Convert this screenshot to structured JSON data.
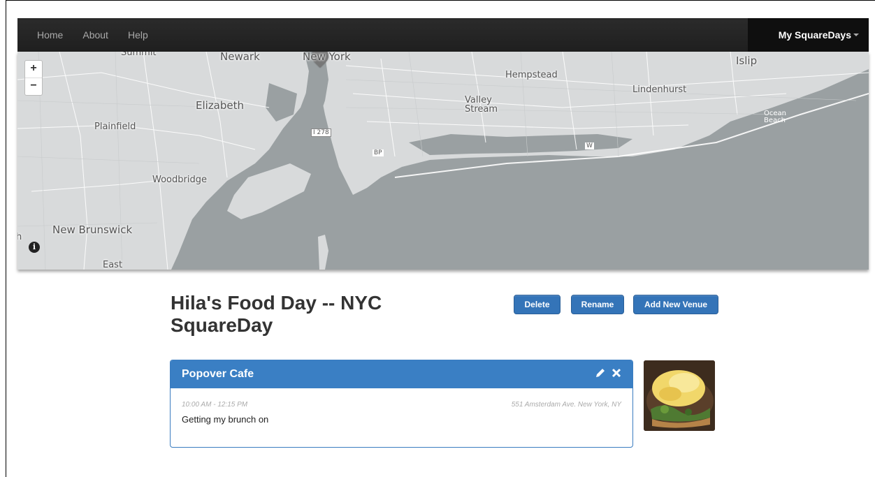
{
  "navbar": {
    "links": [
      "Home",
      "About",
      "Help"
    ],
    "account_menu": "My SquareDays"
  },
  "map": {
    "zoom_in": "+",
    "zoom_out": "−",
    "info": "i",
    "labels": [
      "Summit",
      "Newark",
      "New York",
      "Hempstead",
      "Islip",
      "Lindenhurst",
      "Elizabeth",
      "Valley Stream",
      "Plainfield",
      "Ocean Beach",
      "Woodbridge",
      "New Brunswick",
      "East",
      "I 278",
      "BP",
      "W",
      "h"
    ]
  },
  "day": {
    "title": "Hila's Food Day -- NYC SquareDay",
    "buttons": {
      "delete": "Delete",
      "rename": "Rename",
      "add_venue": "Add New Venue"
    }
  },
  "venue": {
    "name": "Popover Cafe",
    "time": "10:00 AM - 12:15 PM",
    "address": "551 Amsterdam Ave. New York, NY",
    "description": "Getting my brunch on",
    "icons": [
      "pencil-icon",
      "close-icon"
    ]
  },
  "colors": {
    "navbar": "#222222",
    "primary_button": "#3474b8",
    "panel_header": "#3a7fc4",
    "map_water": "#9aa0a2",
    "map_land": "#d8dadb"
  }
}
